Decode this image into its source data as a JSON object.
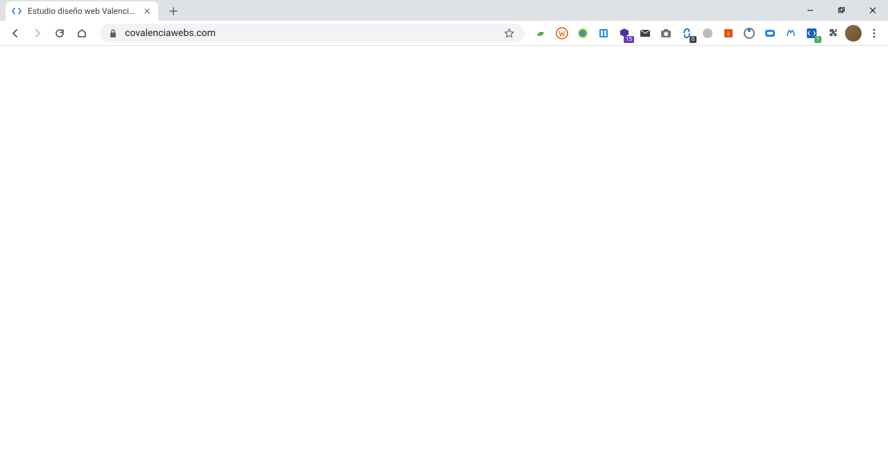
{
  "tab": {
    "title": "Estudio diseño web Valencia | Ag"
  },
  "omnibox": {
    "url": "covalenciawebs.com"
  },
  "extensions": {
    "badge_15": "15",
    "badge_0": "0",
    "badge_1": "1"
  }
}
